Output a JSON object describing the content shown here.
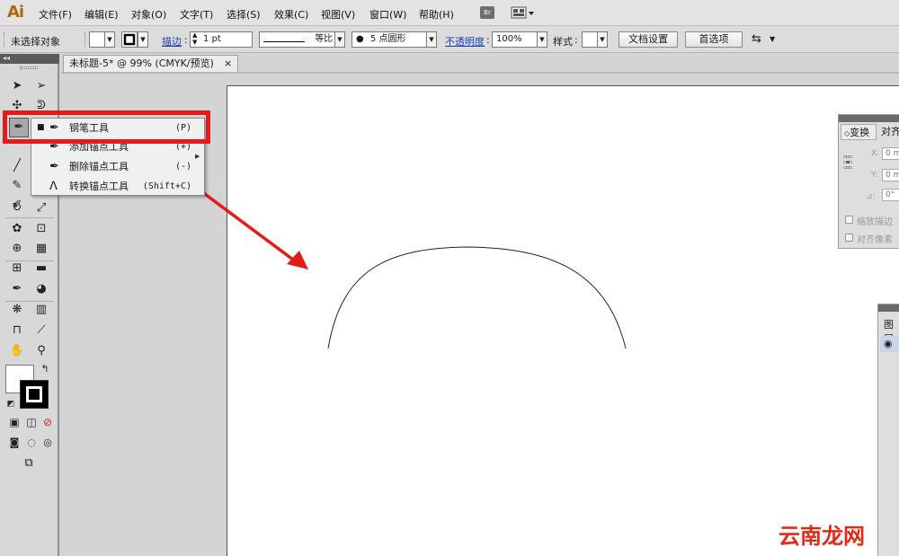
{
  "app": {
    "logo": "Ai"
  },
  "menu": [
    {
      "label": "文件(F)"
    },
    {
      "label": "编辑(E)"
    },
    {
      "label": "对象(O)"
    },
    {
      "label": "文字(T)"
    },
    {
      "label": "选择(S)"
    },
    {
      "label": "效果(C)"
    },
    {
      "label": "视图(V)"
    },
    {
      "label": "窗口(W)"
    },
    {
      "label": "帮助(H)"
    }
  ],
  "menu_extras": {
    "bridge": "Br"
  },
  "control": {
    "selection_status": "未选择对象",
    "stroke_label": "描边",
    "stroke_weight": "1 pt",
    "stroke_profile": "等比",
    "brush": "5 点圆形",
    "opacity_label": "不透明度",
    "opacity_value": "100%",
    "style_label": "样式",
    "doc_setup": "文档设置",
    "preferences": "首选项"
  },
  "document": {
    "tab_title": "未标题-5* @ 99% (CMYK/预览)",
    "close_glyph": "×"
  },
  "flyout": {
    "items": [
      {
        "label": "钢笔工具",
        "shortcut": "(P)",
        "selected": true
      },
      {
        "label": "添加锚点工具",
        "shortcut": "(+)",
        "selected": false
      },
      {
        "label": "删除锚点工具",
        "shortcut": "(-)",
        "selected": false
      },
      {
        "label": "转换锚点工具",
        "shortcut": "(Shift+C)",
        "selected": false
      }
    ]
  },
  "transform_panel": {
    "tabs": [
      "变换",
      "对齐"
    ],
    "x_label": "X:",
    "y_label": "Y:",
    "angle_label": "⊿:",
    "x_value": "0 m",
    "y_value": "0 m",
    "angle_value": "0°",
    "checkbox_scale": "缩放描边",
    "checkbox_align": "对齐像素"
  },
  "layers_panel": {
    "tab": "图层"
  },
  "watermark": "云南龙网",
  "colors": {
    "highlight": "#e41b1b",
    "arrow": "#e41b1b",
    "link": "#1b3fb5"
  }
}
